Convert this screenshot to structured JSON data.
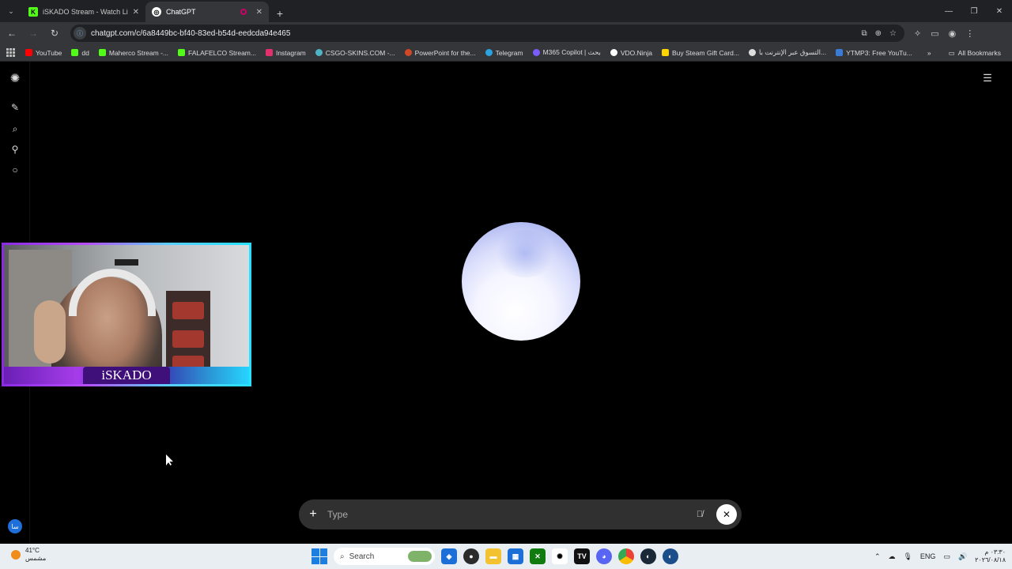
{
  "tabs": [
    {
      "title": "iSKADO Stream - Watch Live on",
      "favicon_color": "#53fc18",
      "favicon_letter": "K",
      "active": false
    },
    {
      "title": "ChatGPT",
      "favicon_color": "#ffffff",
      "favicon_letter": "◎",
      "active": true
    }
  ],
  "toolbar": {
    "url": "chatgpt.com/c/6a8449bc-bf40-83ed-b54d-eedcda94e465"
  },
  "bookmarks": [
    {
      "label": "YouTube",
      "color": "#ff0000"
    },
    {
      "label": "dd",
      "color": "#53fc18"
    },
    {
      "label": "Maherco Stream -...",
      "color": "#53fc18"
    },
    {
      "label": "FALAFELCO Stream...",
      "color": "#53fc18"
    },
    {
      "label": "Instagram",
      "color": "#e1306c"
    },
    {
      "label": "CSGO-SKINS.COM -...",
      "color": "#4fb3c8"
    },
    {
      "label": "PowerPoint for the...",
      "color": "#d24726"
    },
    {
      "label": "Telegram",
      "color": "#2aa3df"
    },
    {
      "label": "M365 Copilot | بحث",
      "color": "#7b5cff"
    },
    {
      "label": "VDO.Ninja",
      "color": "#ffffff"
    },
    {
      "label": "Buy Steam Gift Card...",
      "color": "#ffd500"
    },
    {
      "label": "التسوق عبر الإنترنت با...",
      "color": "#dddddd"
    },
    {
      "label": "YTMP3: Free YouTu...",
      "color": "#3a7bd5"
    }
  ],
  "all_bookmarks_label": "All Bookmarks",
  "webcam": {
    "name": "iSKADO"
  },
  "composer": {
    "placeholder": "Type"
  },
  "profile_initial": "سا",
  "taskbar": {
    "temperature": "41°C",
    "weather_desc": "مشمس",
    "search_label": "Search",
    "lang": "ENG",
    "time": "٠٣:٣٠ م",
    "date": "٢٠٢٦/٠٨/١٨"
  }
}
